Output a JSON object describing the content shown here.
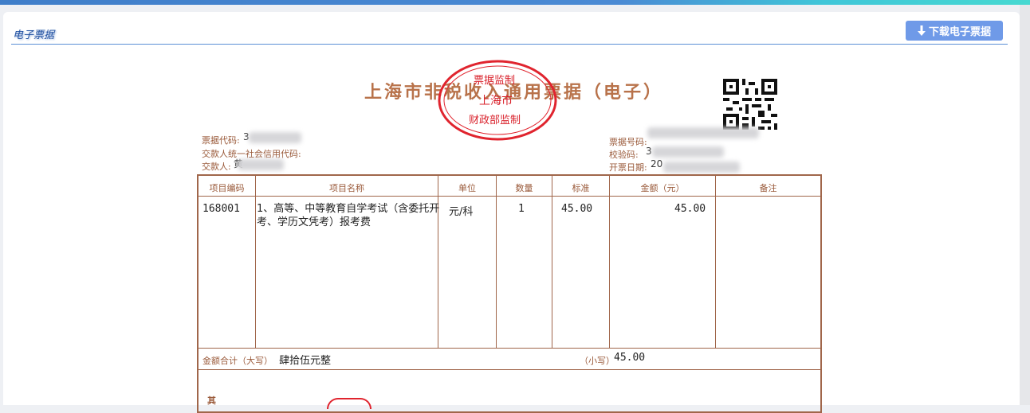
{
  "panel": {
    "title": "电子票据",
    "download_label": "下载电子票据"
  },
  "invoice": {
    "title": "上海市非税收入通用票据（电子）",
    "seal": {
      "top": "票据监制",
      "middle": "上海市",
      "bottom": "财政部监制"
    },
    "left_meta": {
      "code_label": "票据代码:",
      "code_value": "3",
      "credit_label": "交款人统一社会信用代码:",
      "payer_label": "交款人:",
      "payer_value": "黄"
    },
    "right_meta": {
      "number_label": "票据号码:",
      "check_label": "校验码:",
      "check_value": "3",
      "date_label": "开票日期:",
      "date_value": "20"
    },
    "columns": [
      "项目编码",
      "项目名称",
      "单位",
      "数量",
      "标准",
      "金额（元）",
      "备注"
    ],
    "rows": [
      {
        "code": "168001",
        "name": "1、高等、中等教育自学考试（含委托开考、学历文凭考）报考费",
        "unit": "元/科",
        "qty": "1",
        "std": "45.00",
        "amount": "45.00",
        "note": ""
      }
    ],
    "total_upper_label": "金额合计（大写）",
    "total_upper": "肆拾伍元整",
    "total_lower_label": "（小写）",
    "total_lower": "45.00",
    "other_label": "其"
  }
}
